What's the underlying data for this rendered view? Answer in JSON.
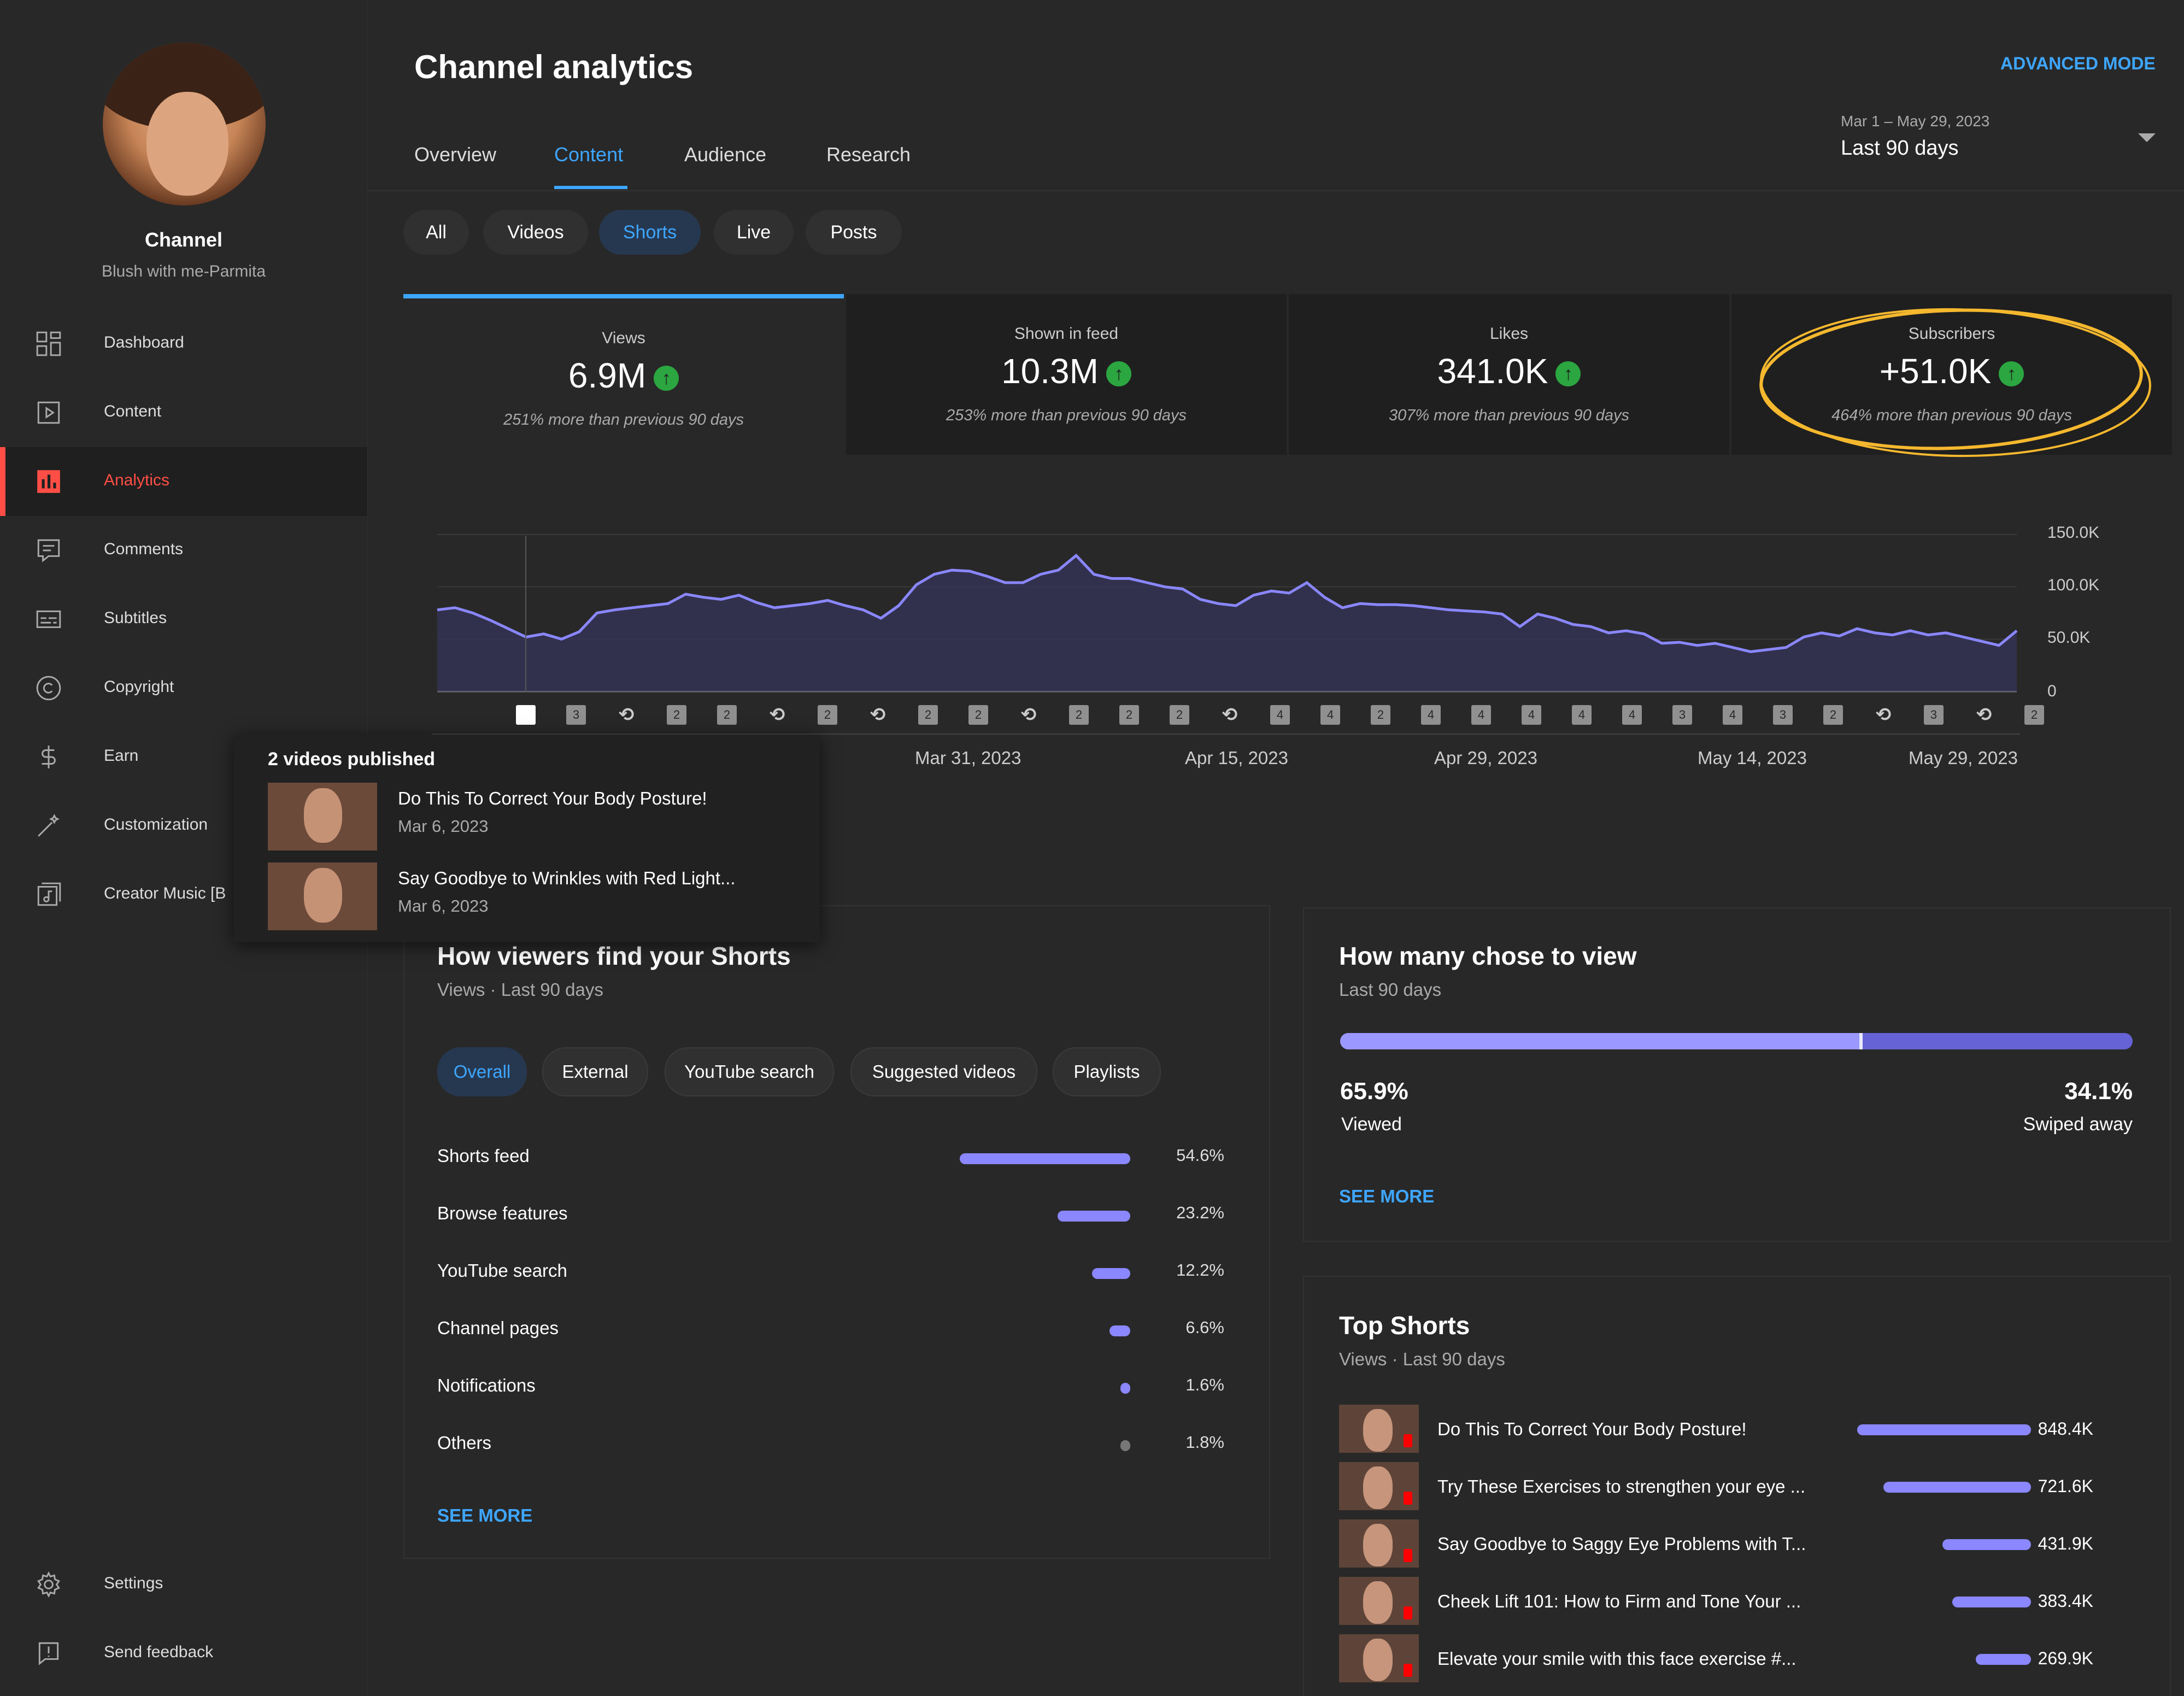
{
  "sidebar": {
    "channel_name": "Channel",
    "channel_handle": "Blush with me-Parmita",
    "items": [
      {
        "label": "Dashboard",
        "icon": "dashboard-icon"
      },
      {
        "label": "Content",
        "icon": "content-icon"
      },
      {
        "label": "Analytics",
        "icon": "analytics-icon",
        "active": true
      },
      {
        "label": "Comments",
        "icon": "comments-icon"
      },
      {
        "label": "Subtitles",
        "icon": "subtitles-icon"
      },
      {
        "label": "Copyright",
        "icon": "copyright-icon"
      },
      {
        "label": "Earn",
        "icon": "earn-icon"
      },
      {
        "label": "Customization",
        "icon": "customization-icon"
      },
      {
        "label": "Creator Music [B",
        "icon": "creator-music-icon"
      }
    ],
    "bottom_items": [
      {
        "label": "Settings",
        "icon": "settings-icon"
      },
      {
        "label": "Send feedback",
        "icon": "feedback-icon"
      }
    ]
  },
  "header": {
    "title": "Channel analytics",
    "advanced_mode": "ADVANCED MODE",
    "date_range_small": "Mar 1 – May 29, 2023",
    "date_range_main": "Last 90 days",
    "tabs": [
      "Overview",
      "Content",
      "Audience",
      "Research"
    ],
    "active_tab": "Content"
  },
  "content_chips": [
    "All",
    "Videos",
    "Shorts",
    "Live",
    "Posts"
  ],
  "active_content_chip": "Shorts",
  "metrics": [
    {
      "label": "Views",
      "value": "6.9M",
      "sub": "251% more than previous 90 days"
    },
    {
      "label": "Shown in feed",
      "value": "10.3M",
      "sub": "253% more than previous 90 days"
    },
    {
      "label": "Likes",
      "value": "341.0K",
      "sub": "307% more than previous 90 days"
    },
    {
      "label": "Subscribers",
      "value": "+51.0K",
      "sub": "464% more than previous 90 days"
    }
  ],
  "chart_data": {
    "type": "area",
    "title": "",
    "xlabel": "",
    "ylabel": "",
    "ylim": [
      0,
      150000
    ],
    "y_ticks": [
      "150.0K",
      "100.0K",
      "50.0K",
      "0"
    ],
    "x_ticks": [
      "Mar 31, 2023",
      "Apr 15, 2023",
      "Apr 29, 2023",
      "May 14, 2023",
      "May 29, 2023"
    ],
    "series": [
      {
        "values": [
          78000,
          80000,
          75000,
          68000,
          60000,
          52000,
          55000,
          50000,
          57000,
          75000,
          78000,
          80000,
          82000,
          84000,
          93000,
          90000,
          88000,
          92000,
          85000,
          80000,
          82000,
          84000,
          87000,
          82000,
          78000,
          70000,
          82000,
          102000,
          112000,
          116000,
          115000,
          110000,
          104000,
          104000,
          112000,
          116000,
          130000,
          112000,
          108000,
          108000,
          104000,
          100000,
          98000,
          88000,
          84000,
          82000,
          92000,
          96000,
          94000,
          104000,
          90000,
          80000,
          84000,
          83000,
          83000,
          82000,
          80000,
          78000,
          77000,
          76000,
          74000,
          62000,
          74000,
          70000,
          64000,
          62000,
          56000,
          58000,
          55000,
          46000,
          47000,
          44000,
          46000,
          42000,
          38000,
          40000,
          42000,
          52000,
          56000,
          53000,
          60000,
          56000,
          54000,
          58000,
          54000,
          56000,
          52000,
          48000,
          44000,
          58000
        ]
      }
    ],
    "publish_markers": [
      "",
      "3",
      "S",
      "2",
      "2",
      "S",
      "2",
      "S",
      "2",
      "2",
      "S",
      "2",
      "2",
      "2",
      "S",
      "4",
      "4",
      "2",
      "4",
      "4",
      "4",
      "4",
      "4",
      "3",
      "4",
      "3",
      "2",
      "S",
      "3",
      "S",
      "2"
    ]
  },
  "popup": {
    "title": "2 videos published",
    "videos": [
      {
        "title": "Do This To Correct Your Body Posture!",
        "date": "Mar 6, 2023"
      },
      {
        "title": "Say Goodbye to Wrinkles with Red Light...",
        "date": "Mar 6, 2023"
      }
    ]
  },
  "find_card": {
    "title": "How viewers find your Shorts",
    "subtitle": "Views · Last 90 days",
    "chips": [
      "Overall",
      "External",
      "YouTube search",
      "Suggested videos",
      "Playlists"
    ],
    "active_chip": "Overall",
    "sources": [
      {
        "label": "Shorts feed",
        "pct": "54.6%",
        "value": 54.6
      },
      {
        "label": "Browse features",
        "pct": "23.2%",
        "value": 23.2
      },
      {
        "label": "YouTube search",
        "pct": "12.2%",
        "value": 12.2
      },
      {
        "label": "Channel pages",
        "pct": "6.6%",
        "value": 6.6
      },
      {
        "label": "Notifications",
        "pct": "1.6%",
        "value": 1.6
      },
      {
        "label": "Others",
        "pct": "1.8%",
        "value": 1.8
      }
    ],
    "see_more": "SEE MORE"
  },
  "view_card": {
    "title": "How many chose to view",
    "subtitle": "Last 90 days",
    "viewed_pct": "65.9%",
    "viewed_value": 65.9,
    "viewed_label": "Viewed",
    "swiped_pct": "34.1%",
    "swiped_label": "Swiped away",
    "see_more": "SEE MORE"
  },
  "top_shorts": {
    "title": "Top Shorts",
    "subtitle": "Views · Last 90 days",
    "items": [
      {
        "title": "Do This To Correct Your Body Posture!",
        "views": "848.4K",
        "value": 848.4
      },
      {
        "title": "Try These Exercises to strengthen your eye ...",
        "views": "721.6K",
        "value": 721.6
      },
      {
        "title": "Say Goodbye to Saggy Eye Problems with T...",
        "views": "431.9K",
        "value": 431.9
      },
      {
        "title": "Cheek Lift 101: How to Firm and Tone Your ...",
        "views": "383.4K",
        "value": 383.4
      },
      {
        "title": "Elevate your smile with this face exercise #...",
        "views": "269.9K",
        "value": 269.9
      }
    ]
  },
  "colors": {
    "accent": "#3ea6ff",
    "active_nav": "#ff4e45",
    "bar": "#8a87ff",
    "up_badge": "#2ba640",
    "highlight": "#f5b82e"
  }
}
